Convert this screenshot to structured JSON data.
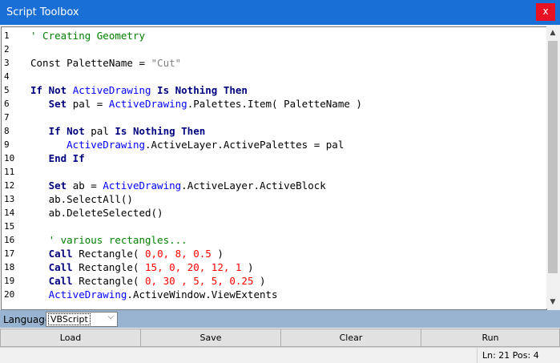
{
  "window": {
    "title": "Script Toolbox",
    "close_label": "x"
  },
  "editor": {
    "line_numbers": [
      "1",
      "2",
      "3",
      "4",
      "5",
      "6",
      "7",
      "8",
      "9",
      "10",
      "11",
      "12",
      "13",
      "14",
      "15",
      "16",
      "17",
      "18",
      "19",
      "20"
    ],
    "lines": [
      [
        {
          "t": "' Creating Geometry",
          "c": "cm"
        }
      ],
      [],
      [
        {
          "t": "Const PaletteName = ",
          "c": "op"
        },
        {
          "t": "\"Cut\"",
          "c": "str"
        }
      ],
      [],
      [
        {
          "t": "If Not ",
          "c": "kw"
        },
        {
          "t": "ActiveDrawing",
          "c": "obj"
        },
        {
          "t": " Is Nothing Then",
          "c": "kw"
        }
      ],
      [
        {
          "t": "   Set ",
          "c": "kw"
        },
        {
          "t": "pal = ",
          "c": "op"
        },
        {
          "t": "ActiveDrawing",
          "c": "obj"
        },
        {
          "t": ".Palettes.Item( PaletteName )",
          "c": "op"
        }
      ],
      [],
      [
        {
          "t": "   If Not ",
          "c": "kw"
        },
        {
          "t": "pal ",
          "c": "op"
        },
        {
          "t": "Is Nothing Then",
          "c": "kw"
        }
      ],
      [
        {
          "t": "      ",
          "c": "op"
        },
        {
          "t": "ActiveDrawing",
          "c": "obj"
        },
        {
          "t": ".ActiveLayer.ActivePalettes = pal",
          "c": "op"
        }
      ],
      [
        {
          "t": "   End If",
          "c": "kw"
        }
      ],
      [],
      [
        {
          "t": "   Set ",
          "c": "kw"
        },
        {
          "t": "ab = ",
          "c": "op"
        },
        {
          "t": "ActiveDrawing",
          "c": "obj"
        },
        {
          "t": ".ActiveLayer.ActiveBlock",
          "c": "op"
        }
      ],
      [
        {
          "t": "   ab.SelectAll()",
          "c": "op"
        }
      ],
      [
        {
          "t": "   ab.DeleteSelected()",
          "c": "op"
        }
      ],
      [],
      [
        {
          "t": "   ' various rectangles...",
          "c": "cm"
        }
      ],
      [
        {
          "t": "   Call ",
          "c": "kw"
        },
        {
          "t": "Rectangle( ",
          "c": "op"
        },
        {
          "t": "0,0, 8, 0.5",
          "c": "num"
        },
        {
          "t": " )",
          "c": "op"
        }
      ],
      [
        {
          "t": "   Call ",
          "c": "kw"
        },
        {
          "t": "Rectangle( ",
          "c": "op"
        },
        {
          "t": "15, 0, 20, 12, 1",
          "c": "num"
        },
        {
          "t": " )",
          "c": "op"
        }
      ],
      [
        {
          "t": "   Call ",
          "c": "kw"
        },
        {
          "t": "Rectangle( ",
          "c": "op"
        },
        {
          "t": "0, 30 , 5, 5, 0.25",
          "c": "num"
        },
        {
          "t": " )",
          "c": "op"
        }
      ],
      [
        {
          "t": "   ",
          "c": "op"
        },
        {
          "t": "ActiveDrawing",
          "c": "obj"
        },
        {
          "t": ".ActiveWindow.ViewExtents",
          "c": "op"
        }
      ]
    ]
  },
  "language": {
    "label": "Language",
    "selected": "VBScript"
  },
  "buttons": {
    "load": "Load",
    "save": "Save",
    "clear": "Clear",
    "run": "Run"
  },
  "status": {
    "position": "Ln: 21 Pos: 4"
  },
  "colors": {
    "titlebar": "#1a6fd6",
    "close": "#e81123",
    "keyword": "#00007f",
    "object": "#0000ff",
    "comment": "#008000",
    "string": "#808080",
    "number": "#ff0000"
  }
}
